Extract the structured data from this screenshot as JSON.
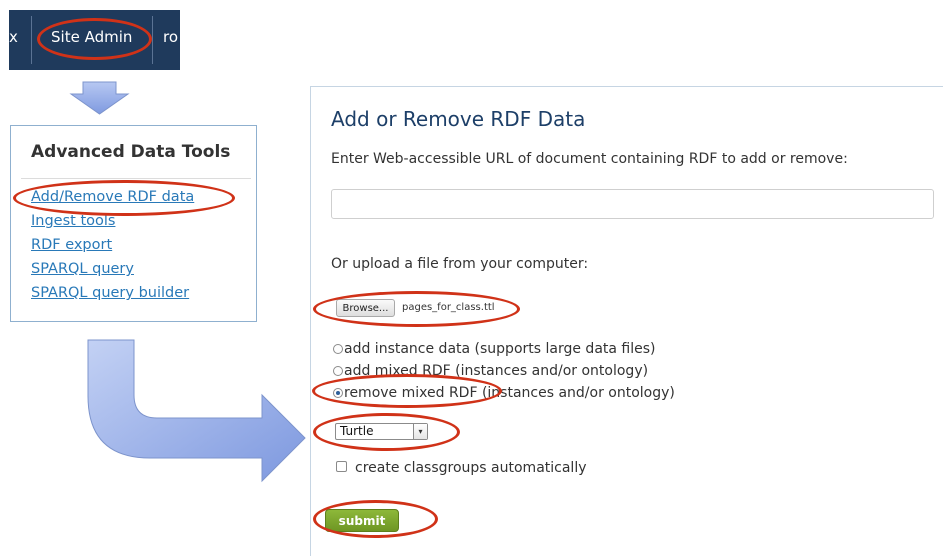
{
  "nav": {
    "left_fragment": "x",
    "site_admin": "Site Admin",
    "right_fragment": "ro"
  },
  "advanced_tools": {
    "title": "Advanced Data Tools",
    "links": [
      "Add/Remove RDF data",
      "Ingest tools",
      "RDF export",
      "SPARQL query",
      "SPARQL query builder"
    ]
  },
  "panel": {
    "title": "Add or Remove RDF Data",
    "url_label": "Enter Web-accessible URL of document containing RDF to add or remove:",
    "url_value": "",
    "upload_label": "Or upload a file from your computer:",
    "browse_label": "Browse...",
    "file_name": "pages_for_class.ttl",
    "radio_options": [
      {
        "label": "add instance data (supports large data files)",
        "checked": false
      },
      {
        "label": "add mixed RDF (instances and/or ontology)",
        "checked": false
      },
      {
        "label": "remove mixed RDF (instances and/or ontology)",
        "checked": true
      }
    ],
    "format_selected": "Turtle",
    "classgroups_label": "create classgroups automatically",
    "classgroups_checked": false,
    "submit_label": "submit"
  },
  "colors": {
    "annotation": "#d03218",
    "nav_bg": "#1f3a5c",
    "link": "#2979b8",
    "title": "#1d3f68",
    "submit_green": "#7aa42c",
    "arrow_blue": "#8ea9e6"
  },
  "icons": {
    "select_arrow": "chevron-down-icon",
    "flow_arrow_down": "arrow-down-icon",
    "flow_arrow_right": "curved-arrow-right-icon"
  }
}
